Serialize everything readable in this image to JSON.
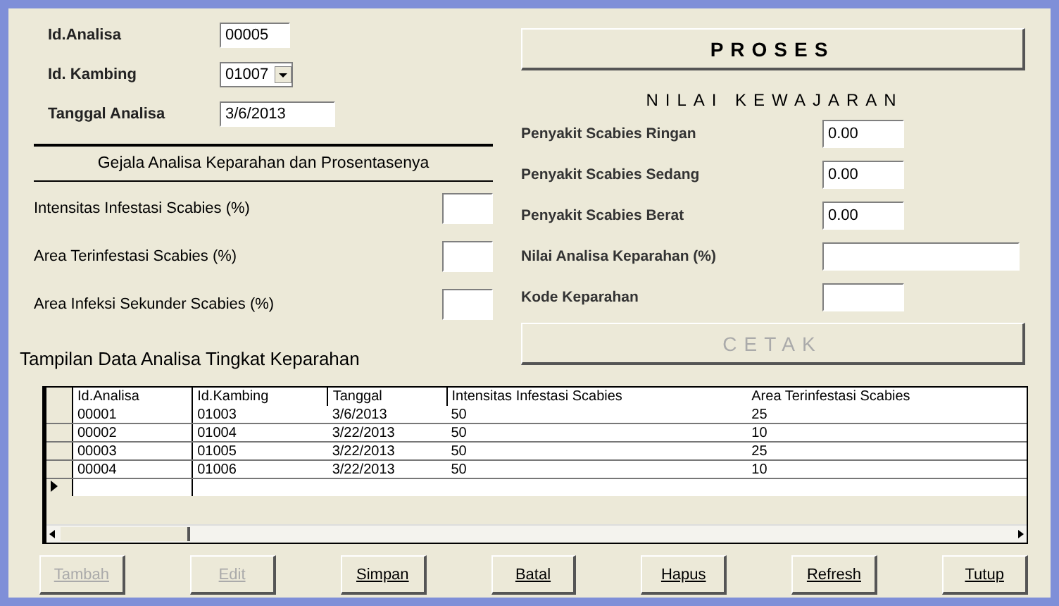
{
  "form": {
    "id_analisa": {
      "label": "Id.Analisa",
      "value": "00005"
    },
    "id_kambing": {
      "label": "Id. Kambing",
      "value": "01007"
    },
    "tanggal": {
      "label": "Tanggal Analisa",
      "value": "3/6/2013"
    },
    "section_title": "Gejala Analisa Keparahan dan Prosentasenya",
    "symptoms": [
      {
        "label": "Intensitas Infestasi Scabies (%)"
      },
      {
        "label": "Area Terinfestasi Scabies (%)"
      },
      {
        "label": "Area Infeksi Sekunder Scabies (%)"
      }
    ],
    "table_title": "Tampilan Data Analisa Tingkat Keparahan"
  },
  "proses_button": {
    "label": "PROSES",
    "disabled": false
  },
  "nilai_title": "NILAI KEWAJARAN",
  "results": [
    {
      "label": "Penyakit Scabies Ringan",
      "value": "0.00",
      "kind": "short"
    },
    {
      "label": "Penyakit Scabies Sedang",
      "value": "0.00",
      "kind": "short"
    },
    {
      "label": "Penyakit Scabies Berat",
      "value": "0.00",
      "kind": "short"
    },
    {
      "label": "Nilai Analisa Keparahan (%)",
      "kind": "long"
    },
    {
      "label": "Kode Keparahan",
      "kind": "short"
    }
  ],
  "cetak_button": {
    "label": "CETAK",
    "disabled": true
  },
  "table": {
    "columns": [
      "Id.Analisa",
      "Id.Kambing",
      "Tanggal",
      "Intensitas Infestasi Scabies",
      "Area Terinfestasi Scabies"
    ],
    "rows": [
      [
        "00001",
        "01003",
        "3/6/2013",
        "50",
        "25"
      ],
      [
        "00002",
        "01004",
        "3/22/2013",
        "50",
        "10"
      ],
      [
        "00003",
        "01005",
        "3/22/2013",
        "50",
        "25"
      ],
      [
        "00004",
        "01006",
        "3/22/2013",
        "50",
        "10"
      ]
    ]
  },
  "buttons": [
    {
      "label": "Tambah",
      "disabled": true
    },
    {
      "label": "Edit",
      "disabled": true
    },
    {
      "label": "Simpan",
      "disabled": false
    },
    {
      "label": "Batal",
      "disabled": false
    },
    {
      "label": "Hapus",
      "disabled": false
    },
    {
      "label": "Refresh",
      "disabled": false
    },
    {
      "label": "Tutup",
      "disabled": false
    }
  ]
}
